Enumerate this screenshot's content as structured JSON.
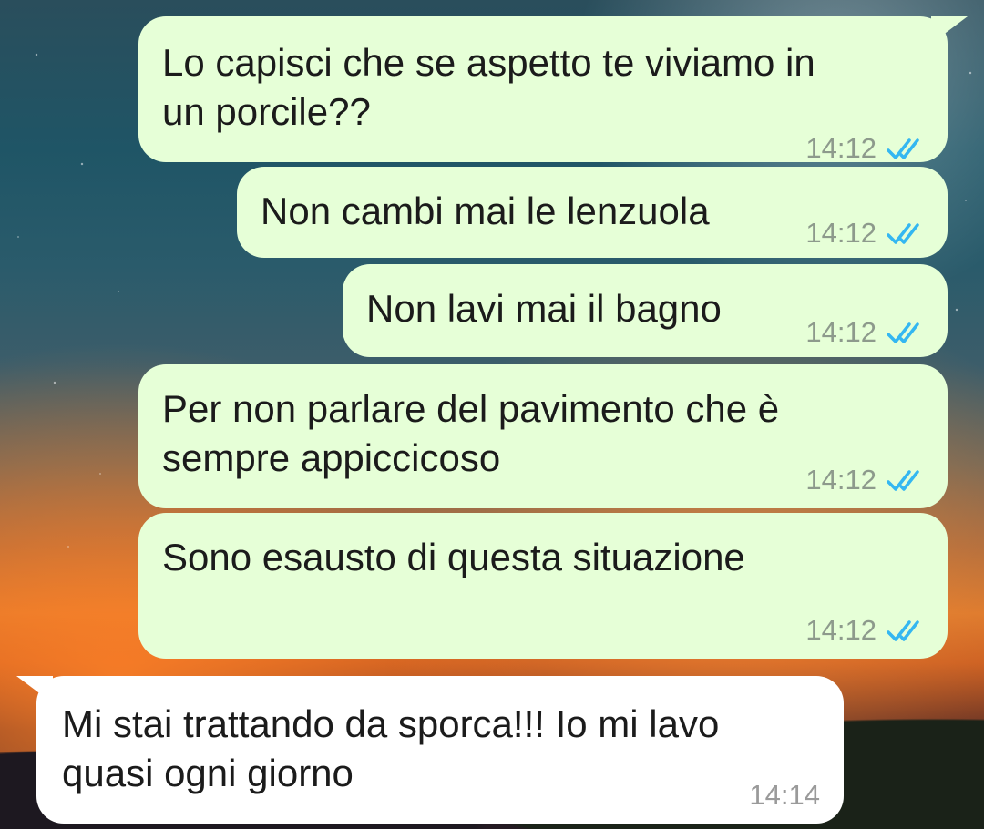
{
  "messages": [
    {
      "text": "Lo capisci che se aspetto te viviamo in\nun porcile??",
      "time": "14:12",
      "status": "read"
    },
    {
      "text": "Non cambi mai le lenzuola",
      "time": "14:12",
      "status": "read"
    },
    {
      "text": "Non lavi mai il bagno",
      "time": "14:12",
      "status": "read"
    },
    {
      "text": "Per non parlare del pavimento che è\nsempre appiccicoso",
      "time": "14:12",
      "status": "read"
    },
    {
      "text": "Sono esausto di questa situazione",
      "time": "14:12",
      "status": "read"
    },
    {
      "text": "Mi stai trattando da sporca!!! Io mi lavo\nquasi ogni giorno",
      "time": "14:14"
    }
  ],
  "colors": {
    "outgoing_bubble": "#e6ffd7",
    "incoming_bubble": "#ffffff",
    "read_tick": "#34b7f1"
  }
}
